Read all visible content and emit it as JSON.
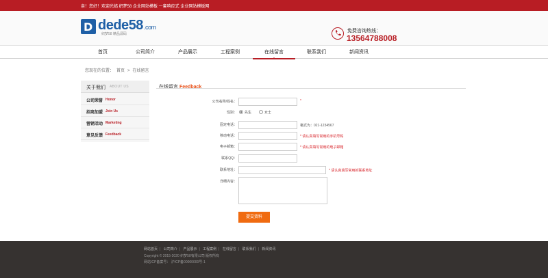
{
  "topbar": {
    "text": "亲！您好！欢迎光临 织梦58 企业网站模板 一套响应式 企业网站模板网"
  },
  "logo": {
    "letter": "D",
    "word": "dede",
    "num": "58",
    "domain": ".com",
    "slogan": "织梦58  精品源码"
  },
  "hotline": {
    "label": "免费咨询热线：",
    "number": "13564788008"
  },
  "nav": {
    "items": [
      {
        "label": "首页"
      },
      {
        "label": "公司简介"
      },
      {
        "label": "产品展示"
      },
      {
        "label": "工程案例"
      },
      {
        "label": "在线留言"
      },
      {
        "label": "联系我们"
      },
      {
        "label": "新闻资讯"
      }
    ],
    "active": "在线留言"
  },
  "breadcrumb": {
    "prefix": "您现在的位置：",
    "home": "首页",
    "sep": ">",
    "current": "在线留言"
  },
  "sidebar": {
    "title_cn": "关于我们",
    "title_en": "ABOUT US",
    "items": [
      {
        "cn": "公司荣誉",
        "en": "Honor"
      },
      {
        "cn": "招商加盟",
        "en": "Join Us"
      },
      {
        "cn": "营销活动",
        "en": "Marketing"
      },
      {
        "cn": "意见反馈",
        "en": "Feedback"
      }
    ]
  },
  "content": {
    "title_cn": "在线留言",
    "title_en": "Feedback"
  },
  "form": {
    "company_label": "公司名称/姓名：",
    "company_req": "*",
    "gender_label": "性别：",
    "gender_male": "先生",
    "gender_female": "女士",
    "phone_label": "固定电话：",
    "phone_hint": "格式为：021-1234567",
    "mobile_label": "移动电话：",
    "mobile_hint": "* 请认真填写常用的手机号码",
    "email_label": "电子邮箱：",
    "email_hint": "* 请认真填写常用的电子邮箱",
    "contact_label": "联系QQ：",
    "address_label": "联系地址：",
    "address_hint": "* 请认真填写常用的联系地址",
    "message_label": "详细内容：",
    "submit_label": "提交资料"
  },
  "footer": {
    "links": [
      "网站首页",
      "公司简介",
      "产品展示",
      "工程案例",
      "在线留言",
      "联系我们",
      "新闻资讯"
    ],
    "separator": "|",
    "copyright": "Copyright © 2015-2020 织梦58有限公司 版权所有",
    "icp": "网站ICP备案号： 沪ICP备00000000号-1"
  },
  "colors": {
    "brand_red": "#b81d24",
    "accent_orange": "#f06b10",
    "logo_blue": "#1e5fa6",
    "footer_bg": "#363230"
  }
}
